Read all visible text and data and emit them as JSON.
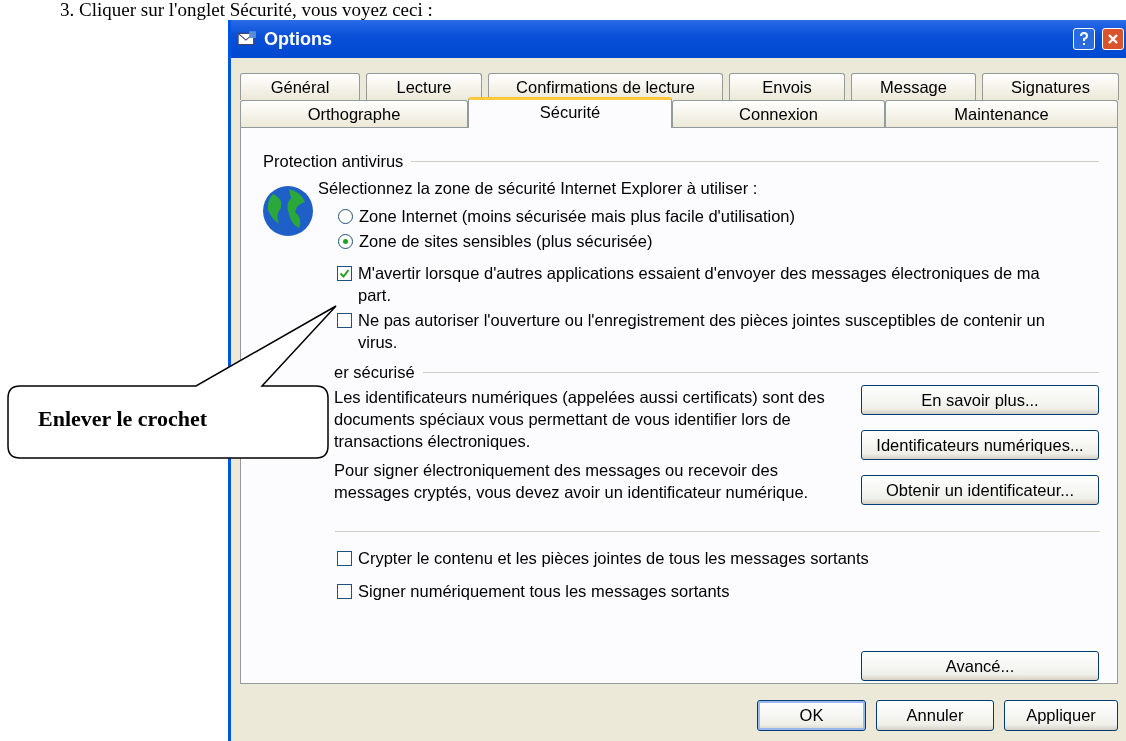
{
  "document_text": "3.   Cliquer sur l'onglet Sécurité, vous voyez ceci :",
  "window": {
    "title": "Options"
  },
  "tab_rows": [
    {
      "tabs": [
        {
          "label": "Général",
          "selected": false
        },
        {
          "label": "Lecture",
          "selected": false
        },
        {
          "label": "Confirmations de lecture",
          "selected": false
        },
        {
          "label": "Envois",
          "selected": false
        },
        {
          "label": "Message",
          "selected": false
        },
        {
          "label": "Signatures",
          "selected": false
        }
      ]
    },
    {
      "tabs": [
        {
          "label": "Orthographe",
          "selected": false
        },
        {
          "label": "Sécurité",
          "selected": true
        },
        {
          "label": "Connexion",
          "selected": false
        },
        {
          "label": "Maintenance",
          "selected": false
        }
      ]
    }
  ],
  "antivirus": {
    "heading": "Protection antivirus",
    "zone_prompt": "Sélectionnez la zone de sécurité Internet Explorer à utiliser :",
    "zones": [
      {
        "label": "Zone Internet (moins sécurisée mais plus facile d'utilisation)",
        "selected": false
      },
      {
        "label": "Zone de sites sensibles (plus sécurisée)",
        "selected": true
      }
    ],
    "options": [
      {
        "label": "M'avertir lorsque d'autres applications essaient d'envoyer des messages électroniques de ma part.",
        "checked": true
      },
      {
        "label": "Ne pas autoriser l'ouverture ou l'enregistrement des pièces jointes susceptibles de contenir un virus.",
        "checked": false
      }
    ]
  },
  "secure_mail": {
    "heading": "er sécurisé",
    "paragraphs": [
      "Les identificateurs numériques (appelées aussi certificats) sont des documents spéciaux vous permettant de vous identifier lors de transactions électroniques.",
      "Pour signer électroniquement des messages ou recevoir des messages cryptés, vous devez avoir un identificateur numérique."
    ],
    "buttons": [
      "En savoir plus...",
      "Identificateurs numériques...",
      "Obtenir un identificateur..."
    ]
  },
  "send_options": [
    {
      "label": "Crypter le contenu et les pièces jointes de tous les messages sortants",
      "checked": false
    },
    {
      "label": "Signer numériquement tous les messages sortants",
      "checked": false
    }
  ],
  "advanced_button": "Avancé...",
  "dialog_buttons": [
    {
      "label": "OK",
      "default": true
    },
    {
      "label": "Annuler",
      "default": false
    },
    {
      "label": "Appliquer",
      "default": false
    }
  ],
  "callout": {
    "text": "Enlever le crochet"
  }
}
